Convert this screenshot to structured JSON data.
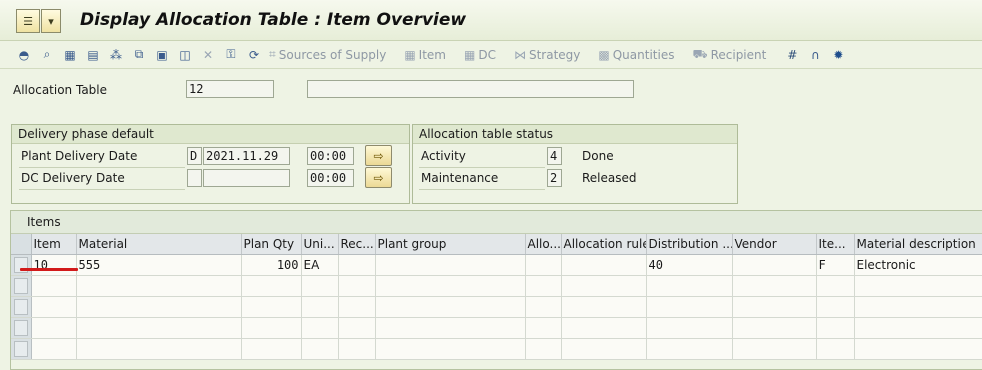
{
  "header": {
    "title": "Display Allocation Table : Item Overview",
    "menu_icon": "menu-icon",
    "dropdown_icon": "dropdown-icon"
  },
  "toolbar": {
    "icons": [
      "header-icon",
      "details-icon",
      "calendar-icon",
      "deliveries-icon",
      "network-icon",
      "copy-icon",
      "doc-icon",
      "doc-alt-icon",
      "delete-icon",
      "lock-icon",
      "refresh-icon"
    ],
    "sources_of_supply": "Sources of Supply",
    "item": "Item",
    "dc": "DC",
    "strategy": "Strategy",
    "quantities": "Quantities",
    "recipient": "Recipient"
  },
  "allocation": {
    "label": "Allocation Table",
    "number": "12",
    "description": ""
  },
  "delivery_phase": {
    "title": "Delivery phase default",
    "plant_label": "Plant Delivery Date",
    "plant_type": "D",
    "plant_date": "2021.11.29",
    "plant_time": "00:00",
    "dc_label": "DC Delivery Date",
    "dc_type": "",
    "dc_date": "",
    "dc_time": "00:00"
  },
  "status": {
    "title": "Allocation table status",
    "activity_label": "Activity",
    "activity_code": "4",
    "activity_text": "Done",
    "maintenance_label": "Maintenance",
    "maintenance_code": "2",
    "maintenance_text": "Released"
  },
  "items": {
    "title": "Items",
    "columns": [
      "Item",
      "Material",
      "Plan Qty",
      "Uni...",
      "Rec...",
      "Plant group",
      "Allo...",
      "Allocation rule",
      "Distribution ...",
      "Vendor",
      "Ite...",
      "Material description"
    ],
    "rows": [
      {
        "item": "10",
        "material": "555",
        "plan_qty": "100",
        "unit": "EA",
        "rec": "",
        "plant_group": "",
        "allo": "",
        "allocation_rule": "",
        "distribution": "40",
        "vendor": "",
        "item_cat": "F",
        "material_description": "Electronic"
      }
    ]
  }
}
